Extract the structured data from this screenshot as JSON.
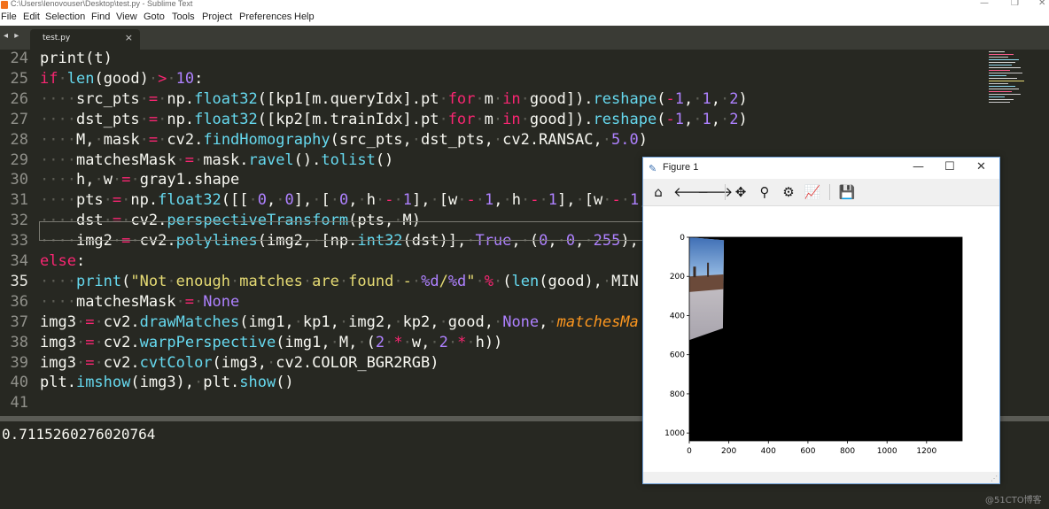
{
  "window": {
    "title": "C:\\Users\\lenovouser\\Desktop\\test.py - Sublime Text",
    "minimize": "—",
    "maximize": "❐",
    "close": "✕"
  },
  "menu": [
    "File",
    "Edit",
    "Selection",
    "Find",
    "View",
    "Goto",
    "Tools",
    "Project",
    "Preferences",
    "Help"
  ],
  "tabs": {
    "nav": "◂ ▸",
    "active": {
      "label": "test.py",
      "close": "×"
    }
  },
  "editor": {
    "current_line": "35",
    "line_numbers": [
      "24",
      "25",
      "26",
      "27",
      "28",
      "29",
      "30",
      "31",
      "32",
      "33",
      "34",
      "35",
      "36",
      "37",
      "38",
      "39",
      "40",
      "41"
    ],
    "colors": {
      "keyword": "#f92672",
      "function": "#66d9ef",
      "number": "#ae81ff",
      "string": "#e6db74",
      "param": "#fd971f",
      "background": "#272822"
    }
  },
  "console": {
    "output": "0.7115260276020764"
  },
  "watermark": "@51CTO博客",
  "figure": {
    "title": "Figure 1",
    "icon": "app-icon",
    "minimize": "—",
    "maximize": "☐",
    "close": "✕",
    "toolbar": [
      {
        "name": "home-icon",
        "glyph": "⌂"
      },
      {
        "name": "back-arrow-icon",
        "glyph": "🡐"
      },
      {
        "name": "forward-arrow-icon",
        "glyph": "🡒"
      },
      {
        "name": "pan-icon",
        "glyph": "✥"
      },
      {
        "name": "zoom-icon",
        "glyph": "⚲"
      },
      {
        "name": "configure-subplots-icon",
        "glyph": "⚙"
      },
      {
        "name": "edit-axis-icon",
        "glyph": "📈"
      },
      {
        "name": "save-icon",
        "glyph": "💾"
      }
    ],
    "chart_data": {
      "type": "image",
      "x_ticks": [
        "0",
        "200",
        "400",
        "600",
        "800",
        "1000",
        "1200"
      ],
      "y_ticks": [
        "0",
        "200",
        "400",
        "600",
        "800",
        "1000"
      ],
      "xlim": [
        0,
        1380
      ],
      "ylim": [
        1040,
        0
      ],
      "background_color": "#000000",
      "content": "warped photo in upper-left region"
    }
  }
}
